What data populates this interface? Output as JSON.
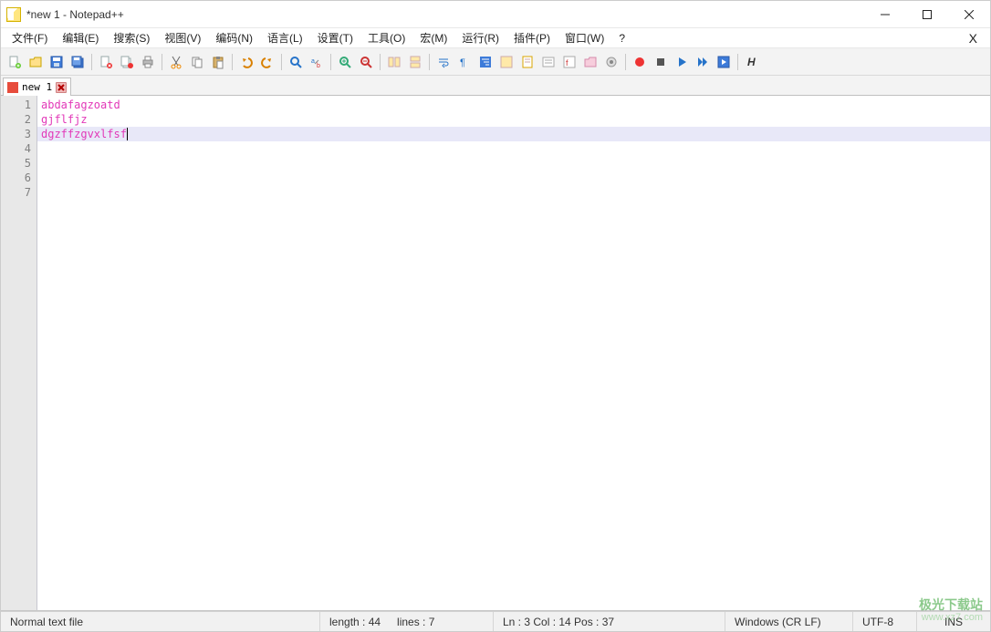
{
  "window": {
    "title": "*new 1 - Notepad++"
  },
  "menu": [
    "文件(F)",
    "编辑(E)",
    "搜索(S)",
    "视图(V)",
    "编码(N)",
    "语言(L)",
    "设置(T)",
    "工具(O)",
    "宏(M)",
    "运行(R)",
    "插件(P)",
    "窗口(W)",
    "?"
  ],
  "tabs": [
    {
      "label": "new 1",
      "modified": true
    }
  ],
  "editor": {
    "lines": [
      "abdafagzoatd",
      "gjflfjz",
      "dgzffzgvxlfsf",
      "",
      "",
      "",
      ""
    ],
    "current_line_index": 2
  },
  "status": {
    "left": "Normal text file",
    "length_label": "length : 44",
    "lines_label": "lines : 7",
    "pos_label": "Ln : 3    Col : 14    Pos : 37",
    "eol": "Windows (CR LF)",
    "encoding": "UTF-8",
    "mode": "INS"
  },
  "watermark": {
    "line1": "极光下载站",
    "line2": "www.xz7.com"
  }
}
